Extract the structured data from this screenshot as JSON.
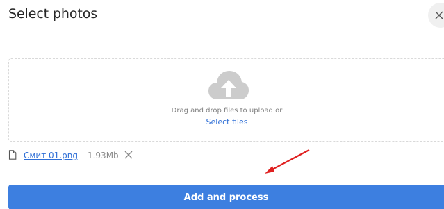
{
  "dialog": {
    "title": "Select photos",
    "close_icon": "close-icon"
  },
  "dropzone": {
    "icon": "cloud-upload-icon",
    "instruction": "Drag and drop files to upload or",
    "select_label": "Select files"
  },
  "files": [
    {
      "icon": "file-icon",
      "name": "Смит 01.png",
      "size": "1.93Mb",
      "remove_icon": "remove-icon"
    }
  ],
  "actions": {
    "primary_label": "Add and process"
  },
  "annotation": {
    "icon": "red-arrow-icon",
    "color": "#e02020"
  },
  "colors": {
    "accent": "#3d7fe0",
    "link": "#2f6fd6"
  }
}
